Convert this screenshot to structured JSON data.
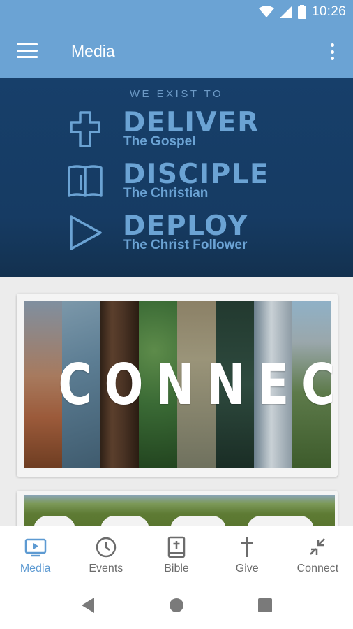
{
  "status_bar": {
    "time": "10:26"
  },
  "app_bar": {
    "title": "Media"
  },
  "hero": {
    "kicker": "WE EXIST TO",
    "rows": [
      {
        "big": "DELIVER",
        "small": "The Gospel",
        "icon": "cross-icon"
      },
      {
        "big": "DISCIPLE",
        "small": "The Christian",
        "icon": "bible-icon"
      },
      {
        "big": "DEPLOY",
        "small": "The Christ Follower",
        "icon": "play-icon"
      }
    ],
    "colors": {
      "background": "#173f6a",
      "accent": "#6ba3d4",
      "kicker": "#6d9ac6"
    }
  },
  "media_cards": [
    {
      "title": "CONNECT",
      "strip_colors": [
        "#9b5a3a",
        "#5c7d93",
        "#4a3324",
        "#3a6a35",
        "#8a8a6e",
        "#2e4a3e",
        "#a7b3bd",
        "#5d7a4a"
      ]
    },
    {
      "title": ""
    }
  ],
  "bottom_nav": {
    "items": [
      {
        "label": "Media",
        "icon": "tv-icon",
        "active": true
      },
      {
        "label": "Events",
        "icon": "clock-icon",
        "active": false
      },
      {
        "label": "Bible",
        "icon": "bible-icon",
        "active": false
      },
      {
        "label": "Give",
        "icon": "cross-icon",
        "active": false
      },
      {
        "label": "Connect",
        "icon": "compress-arrows-icon",
        "active": false
      }
    ]
  },
  "theme": {
    "primary": "#6ba3d4",
    "active_nav": "#5d9ad2",
    "inactive_nav": "#6c6c6c"
  }
}
